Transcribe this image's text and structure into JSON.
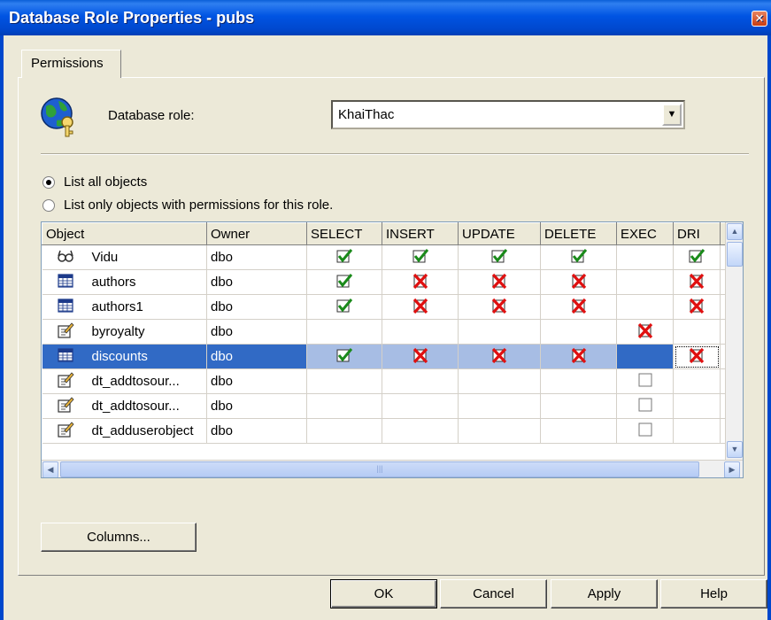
{
  "window": {
    "title": "Database Role Properties - pubs",
    "close_label": "×"
  },
  "tabs": [
    {
      "label": "Permissions"
    }
  ],
  "role": {
    "label": "Database role:",
    "value": "KhaiThac"
  },
  "options": {
    "list_all": "List all objects",
    "list_only": "List only objects with permissions for this role."
  },
  "grid": {
    "columns": [
      "Object",
      "Owner",
      "SELECT",
      "INSERT",
      "UPDATE",
      "DELETE",
      "EXEC",
      "DRI"
    ],
    "rows": [
      {
        "icon": "view-icon",
        "name": "Vidu",
        "owner": "dbo",
        "perms": [
          "check",
          "check",
          "check",
          "check",
          "",
          "check"
        ]
      },
      {
        "icon": "table-icon",
        "name": "authors",
        "owner": "dbo",
        "perms": [
          "check",
          "deny",
          "deny",
          "deny",
          "",
          "deny"
        ]
      },
      {
        "icon": "table-icon",
        "name": "authors1",
        "owner": "dbo",
        "perms": [
          "check",
          "deny",
          "deny",
          "deny",
          "",
          "deny"
        ]
      },
      {
        "icon": "stored-procedure-icon",
        "name": "byroyalty",
        "owner": "dbo",
        "perms": [
          "",
          "",
          "",
          "",
          "deny",
          ""
        ]
      },
      {
        "icon": "table-icon",
        "name": "discounts",
        "owner": "dbo",
        "perms": [
          "check",
          "deny",
          "deny",
          "deny",
          "",
          "deny"
        ],
        "selected": true
      },
      {
        "icon": "stored-procedure-icon",
        "name": "dt_addtosour...",
        "owner": "dbo",
        "perms": [
          "",
          "",
          "",
          "",
          "empty",
          ""
        ]
      },
      {
        "icon": "stored-procedure-icon",
        "name": "dt_addtosour...",
        "owner": "dbo",
        "perms": [
          "",
          "",
          "",
          "",
          "empty",
          ""
        ]
      },
      {
        "icon": "stored-procedure-icon",
        "name": "dt_adduserobject",
        "owner": "dbo",
        "perms": [
          "",
          "",
          "",
          "",
          "empty",
          ""
        ]
      }
    ]
  },
  "buttons": {
    "columns": "Columns...",
    "ok": "OK",
    "cancel": "Cancel",
    "apply": "Apply",
    "help": "Help"
  },
  "colors": {
    "title_bar": "#0054e3",
    "selection": "#316ac5",
    "check": "#1a8a1a",
    "deny": "#e01010"
  }
}
